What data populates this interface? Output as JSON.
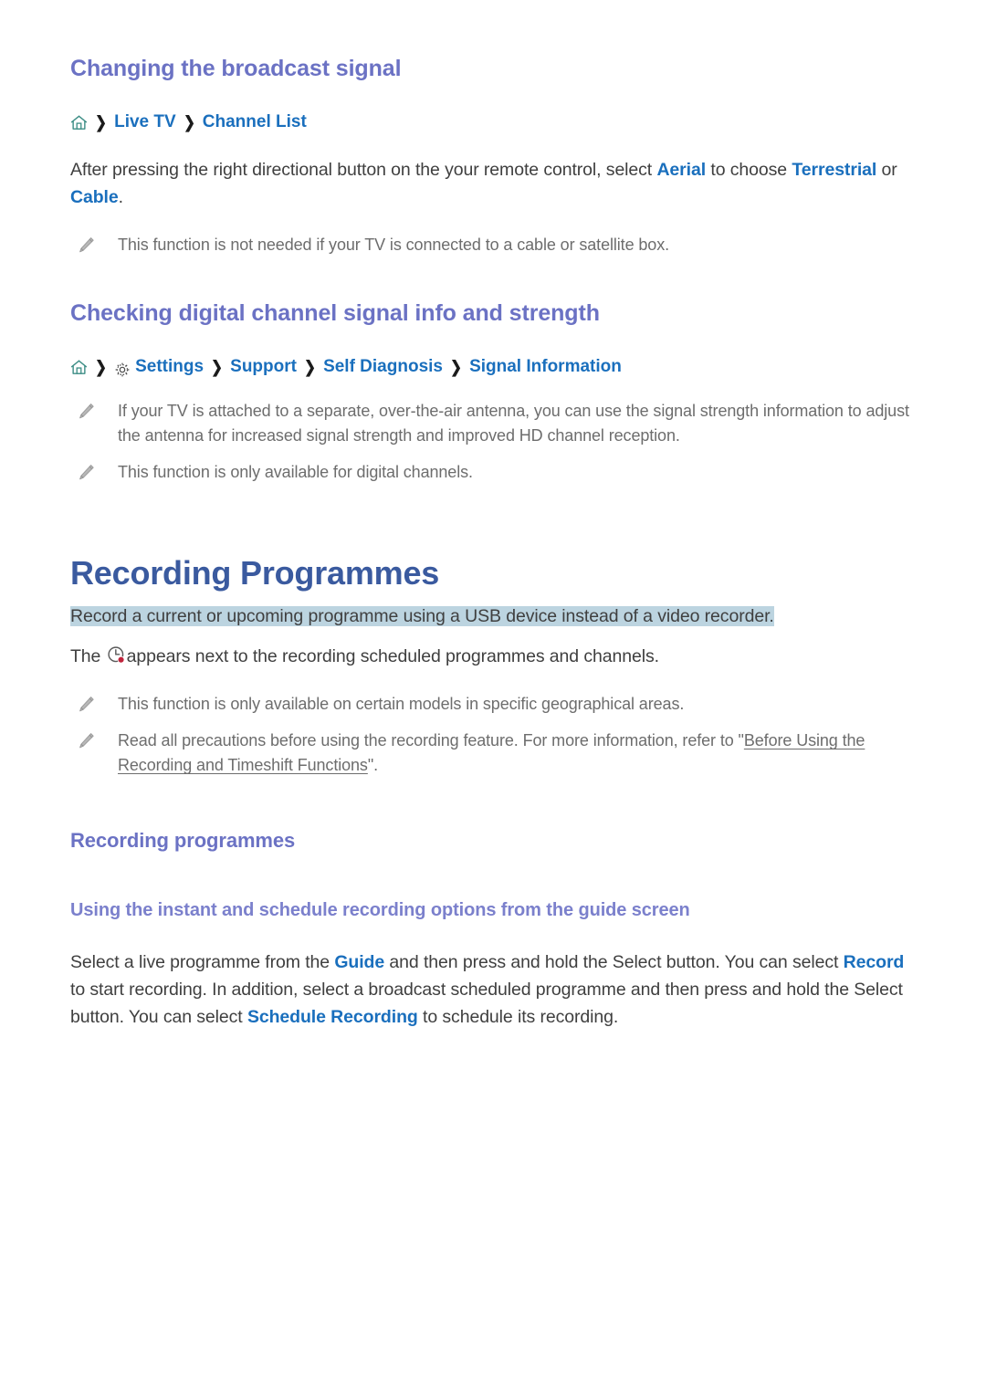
{
  "document": {
    "sections": [
      {
        "id": "changing-broadcast-signal",
        "heading": "Changing the broadcast signal",
        "breadcrumb": {
          "home_icon": "home-icon",
          "separator": "❯",
          "items": [
            "Live TV",
            "Channel List"
          ]
        },
        "paragraph": {
          "p1": "After pressing the right directional button on the your remote control, select ",
          "link1": "Aerial",
          "p2": " to choose ",
          "link2": "Terrestrial",
          "p3": " or ",
          "link3": "Cable",
          "p4": "."
        },
        "notes": [
          "This function is not needed if your TV is connected to a cable or satellite box."
        ]
      },
      {
        "id": "checking-digital-channel-signal",
        "heading": "Checking digital channel signal info and strength",
        "breadcrumb": {
          "home_icon": "home-icon",
          "gear_icon": "gear-icon",
          "separator": "❯",
          "items": [
            "Settings",
            "Support",
            "Self Diagnosis",
            "Signal Information"
          ]
        },
        "notes": [
          "If your TV is attached to a separate, over-the-air antenna, you can use the signal strength information to adjust the antenna for increased signal strength and improved HD channel reception.",
          "This function is only available for digital channels."
        ]
      }
    ],
    "chapter": {
      "id": "recording-programmes",
      "title": "Recording Programmes",
      "highlight_summary": "Record a current or upcoming programme using a USB device instead of a video recorder.",
      "icon_sentence": {
        "pre": "The ",
        "icon": "record-clock-icon",
        "post": "appears next to the recording scheduled programmes and channels."
      },
      "notes": [
        {
          "text": "This function is only available on certain models in specific geographical areas."
        },
        {
          "pre": "Read all precautions before using the recording feature. For more information, refer to \"",
          "link": "Before Using the Recording and Timeshift Functions",
          "post": "\"."
        }
      ],
      "subsection": {
        "heading": "Recording programmes",
        "topic": {
          "heading": "Using the instant and schedule recording options from the guide screen",
          "paragraph": {
            "p1": "Select a live programme from the ",
            "link1": "Guide",
            "p2": " and then press and hold the Select button. You can select ",
            "link2": "Record",
            "p3": " to start recording. In addition, select a broadcast scheduled programme and then press and hold the Select button. You can select ",
            "link3": "Schedule Recording",
            "p4": " to schedule its recording."
          }
        }
      }
    },
    "colors": {
      "h1": "#3a5a9f",
      "h2": "#6b72c4",
      "h4": "#7b80cc",
      "link": "#1a6fbd",
      "body": "#3f3f3f",
      "note": "#6d6d6d",
      "highlight": "#bcd4e0",
      "home_icon": "#3f8f87",
      "record_dot": "#c0243c",
      "background": "#ffffff"
    }
  }
}
